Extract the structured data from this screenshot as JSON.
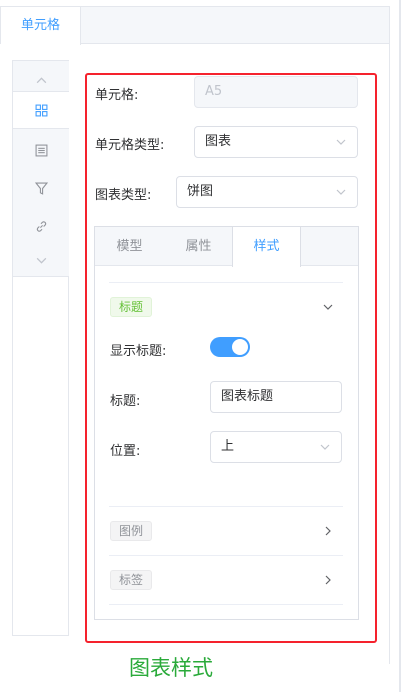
{
  "top_tab": {
    "label": "单元格"
  },
  "sidebar": {
    "items": [
      {
        "icon": "chevron-up-icon"
      },
      {
        "icon": "grid-icon"
      },
      {
        "icon": "list-icon"
      },
      {
        "icon": "filter-icon"
      },
      {
        "icon": "link-icon"
      },
      {
        "icon": "chevron-down-icon"
      }
    ]
  },
  "form": {
    "cell_label": "单元格:",
    "cell_value": "A5",
    "cell_type_label": "单元格类型:",
    "cell_type_value": "图表",
    "chart_type_label": "图表类型:",
    "chart_type_value": "饼图"
  },
  "tabs": [
    {
      "label": "模型"
    },
    {
      "label": "属性"
    },
    {
      "label": "样式"
    }
  ],
  "style_panel": {
    "title_section_tag": "标题",
    "show_title_label": "显示标题:",
    "show_title_on": true,
    "title_label": "标题:",
    "title_value": "图表标题",
    "position_label": "位置:",
    "position_value": "上",
    "legend_section_tag": "图例",
    "label_section_tag": "标签"
  },
  "caption": "图表样式",
  "colors": {
    "accent": "#409eff",
    "highlight": "#f5222d",
    "caption": "#2aaa3a"
  }
}
